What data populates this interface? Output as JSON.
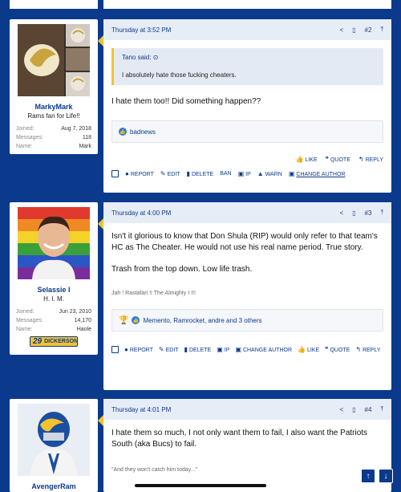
{
  "posts": [
    {
      "date": "Thursday at 3:52 PM",
      "number": "#2",
      "user": {
        "name": "MarkyMark",
        "title": "Rams fan for Life!!",
        "stats": [
          {
            "label": "Joined:",
            "value": "Aug 7, 2018"
          },
          {
            "label": "Messages:",
            "value": "118"
          },
          {
            "label": "Name:",
            "value": "Mark"
          }
        ]
      },
      "quote": {
        "author": "Tano said:",
        "text": "I absolutely hate those fucking cheaters."
      },
      "body": "I hate them too!! Did something happen??",
      "reactions": "badnews",
      "actions_right": [
        "LIKE",
        "QUOTE",
        "REPLY"
      ],
      "actions_left": [
        "REPORT",
        "EDIT",
        "DELETE",
        "BAN",
        "IP",
        "WARN",
        "CHANGE AUTHOR"
      ]
    },
    {
      "date": "Thursday at 4:00 PM",
      "number": "#3",
      "user": {
        "name": "Selassie I",
        "title": "H. I. M.",
        "badge": "DICKERSON",
        "badge_num": "29",
        "stats": [
          {
            "label": "Joined:",
            "value": "Jun 23, 2010"
          },
          {
            "label": "Messages:",
            "value": "14,170"
          },
          {
            "label": "Name:",
            "value": "Haole"
          }
        ]
      },
      "body": "Isn't it glorious to know that Don Shula (RIP) would only refer to that team's HC as The Cheater. He would not use his real name period. True story.",
      "body2": "Trash from the top down. Low life trash.",
      "signature": "Jah ! Rastafari !! The Almighty I !!!",
      "reactions": "Memento, Ramrocket, andre and 3 others",
      "actions": [
        "REPORT",
        "EDIT",
        "DELETE",
        "IP",
        "CHANGE AUTHOR",
        "LIKE",
        "QUOTE",
        "REPLY"
      ]
    },
    {
      "date": "Thursday at 4:01 PM",
      "number": "#4",
      "user": {
        "name": "AvengerRam"
      },
      "body": "I hate them so much, I not only want them to fail, I also want the Patriots South (aka Bucs) to fail.",
      "signature": "\"And they won't catch him today...\""
    }
  ],
  "colors": {
    "brand": "#0b3a8c",
    "accent": "#f2c230"
  }
}
